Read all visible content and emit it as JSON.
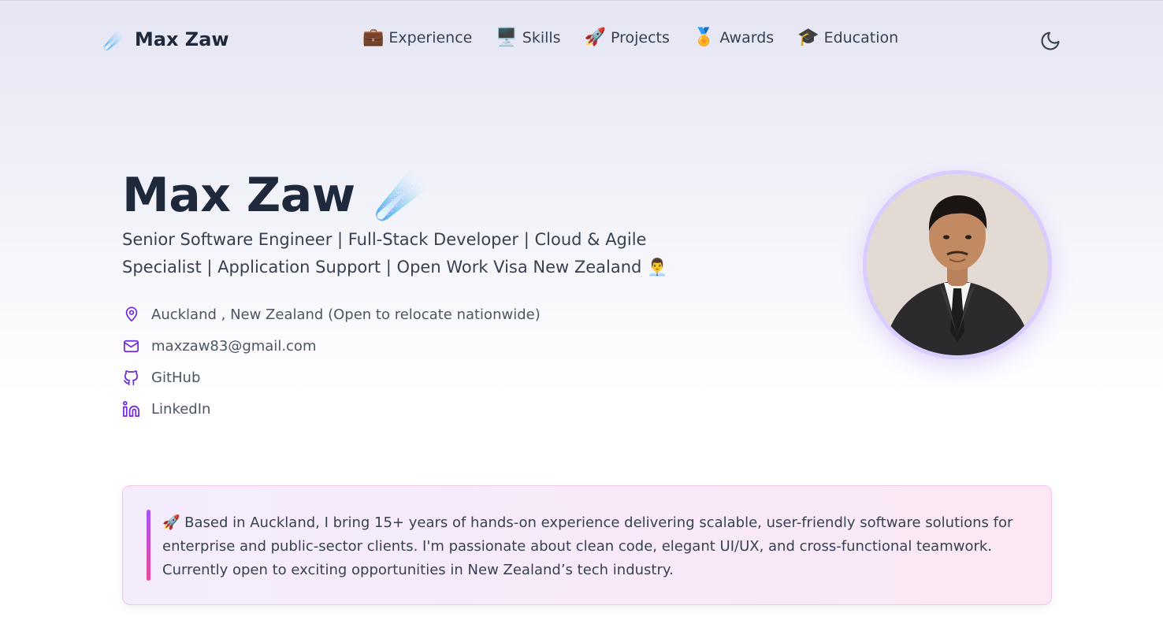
{
  "nav": {
    "brand_emoji": "☄️",
    "brand_name": "Max Zaw",
    "links": [
      {
        "emoji": "💼",
        "label": "Experience"
      },
      {
        "emoji": "🖥️",
        "label": "Skills"
      },
      {
        "emoji": "🚀",
        "label": "Projects"
      },
      {
        "emoji": "🏅",
        "label": "Awards"
      },
      {
        "emoji": "🎓",
        "label": "Education"
      }
    ],
    "theme_toggle_icon": "moon-icon"
  },
  "hero": {
    "name": "Max Zaw",
    "name_emoji": "☄️",
    "subtitle": "Senior Software Engineer | Full-Stack Developer | Cloud & Agile Specialist | Application Support | Open Work Visa New Zealand 👨‍💼",
    "contacts": [
      {
        "icon": "location-pin-icon",
        "text": "Auckland , New Zealand (Open to relocate nationwide)"
      },
      {
        "icon": "mail-icon",
        "text": "maxzaw83@gmail.com"
      },
      {
        "icon": "github-icon",
        "text": "GitHub"
      },
      {
        "icon": "linkedin-icon",
        "text": "LinkedIn"
      }
    ],
    "avatar": "profile-photo"
  },
  "bio": {
    "text": "🚀 Based in Auckland, I bring 15+ years of hands-on experience delivering scalable, user-friendly software solutions for enterprise and public-sector clients. I'm passionate about clean code, elegant UI/UX, and cross-functional teamwork. Currently open to exciting opportunities in New Zealand’s tech industry."
  },
  "colors": {
    "accent": "#6d28d9",
    "text_dark": "#1e293b",
    "bio_bar_top": "#a855f7",
    "bio_bar_bottom": "#ec4899"
  }
}
